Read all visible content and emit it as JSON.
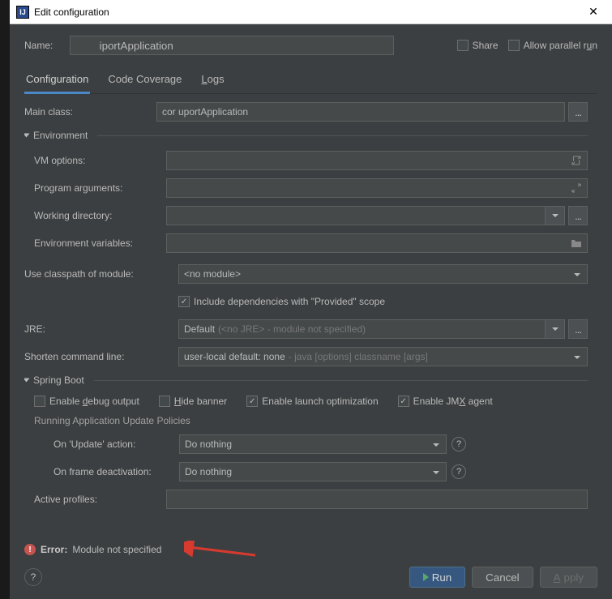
{
  "titlebar": {
    "title": "Edit configuration"
  },
  "name": {
    "label": "Name:",
    "value": "        iportApplication"
  },
  "share": {
    "label": "Share",
    "checked": false
  },
  "parallel": {
    "label": "Allow parallel run",
    "checked": false
  },
  "tabs": {
    "config": "Configuration",
    "coverage": "Code Coverage",
    "logs": "Logs"
  },
  "form": {
    "mainClass": {
      "label": "Main class:",
      "value": "cor       uportApplication"
    },
    "envSection": "Environment",
    "vmOptions": {
      "label": "VM options:",
      "value": ""
    },
    "progArgs": {
      "label": "Program arguments:",
      "value": ""
    },
    "workDir": {
      "label": "Working directory:",
      "value": ""
    },
    "envVars": {
      "label": "Environment variables:",
      "value": ""
    },
    "classpath": {
      "label": "Use classpath of module:",
      "value": "<no module>"
    },
    "includeProvided": {
      "label": "Include dependencies with \"Provided\" scope",
      "checked": true
    },
    "jre": {
      "label": "JRE:",
      "value": "Default",
      "ghost": "(<no JRE> - module not specified)"
    },
    "shorten": {
      "label": "Shorten command line:",
      "value": "user-local default: none",
      "ghost": "- java [options] classname [args]"
    },
    "springSection": "Spring Boot",
    "debugOut": "Enable debug output",
    "hideBanner": "Hide banner",
    "launchOpt": "Enable launch optimization",
    "jmx": "Enable JMX agent",
    "policies": "Running Application Update Policies",
    "onUpdate": {
      "label": "On 'Update' action:",
      "value": "Do nothing"
    },
    "onFrame": {
      "label": "On frame deactivation:",
      "value": "Do nothing"
    },
    "activeProfiles": {
      "label": "Active profiles:"
    }
  },
  "error": {
    "prefix": "Error:",
    "msg": "Module not specified"
  },
  "footer": {
    "run": "Run",
    "cancel": "Cancel",
    "apply": "Apply"
  }
}
